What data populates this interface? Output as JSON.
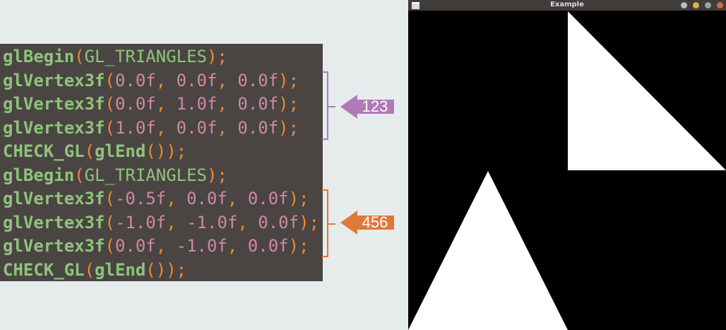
{
  "code": {
    "lines": [
      [
        [
          "fn",
          "glBegin"
        ],
        [
          "p",
          "("
        ],
        [
          "c",
          "GL_TRIANGLES"
        ],
        [
          "p",
          ");"
        ]
      ],
      [
        [
          "fn",
          "glVertex3f"
        ],
        [
          "p",
          "("
        ],
        [
          "n",
          "0.0f"
        ],
        [
          "p",
          ", "
        ],
        [
          "n",
          "0.0f"
        ],
        [
          "p",
          ", "
        ],
        [
          "n",
          "0.0f"
        ],
        [
          "p",
          ");"
        ]
      ],
      [
        [
          "fn",
          "glVertex3f"
        ],
        [
          "p",
          "("
        ],
        [
          "n",
          "0.0f"
        ],
        [
          "p",
          ", "
        ],
        [
          "n",
          "1.0f"
        ],
        [
          "p",
          ", "
        ],
        [
          "n",
          "0.0f"
        ],
        [
          "p",
          ");"
        ]
      ],
      [
        [
          "fn",
          "glVertex3f"
        ],
        [
          "p",
          "("
        ],
        [
          "n",
          "1.0f"
        ],
        [
          "p",
          ", "
        ],
        [
          "n",
          "0.0f"
        ],
        [
          "p",
          ", "
        ],
        [
          "n",
          "0.0f"
        ],
        [
          "p",
          ");"
        ]
      ],
      [
        [
          "fn",
          "CHECK_GL"
        ],
        [
          "p",
          "("
        ],
        [
          "fn",
          "glEnd"
        ],
        [
          "p",
          "());"
        ]
      ],
      [
        [
          "fn",
          "glBegin"
        ],
        [
          "p",
          "("
        ],
        [
          "c",
          "GL_TRIANGLES"
        ],
        [
          "p",
          ");"
        ]
      ],
      [
        [
          "fn",
          "glVertex3f"
        ],
        [
          "p",
          "("
        ],
        [
          "n",
          "-0.5f"
        ],
        [
          "p",
          ", "
        ],
        [
          "n",
          "0.0f"
        ],
        [
          "p",
          ", "
        ],
        [
          "n",
          "0.0f"
        ],
        [
          "p",
          ");"
        ]
      ],
      [
        [
          "fn",
          "glVertex3f"
        ],
        [
          "p",
          "("
        ],
        [
          "n",
          "-1.0f"
        ],
        [
          "p",
          ", "
        ],
        [
          "n",
          "-1.0f"
        ],
        [
          "p",
          ", "
        ],
        [
          "n",
          "0.0f"
        ],
        [
          "p",
          ");"
        ]
      ],
      [
        [
          "fn",
          "glVertex3f"
        ],
        [
          "p",
          "("
        ],
        [
          "n",
          "0.0f"
        ],
        [
          "p",
          ", "
        ],
        [
          "n",
          "-1.0f"
        ],
        [
          "p",
          ", "
        ],
        [
          "n",
          "0.0f"
        ],
        [
          "p",
          ");"
        ]
      ],
      [
        [
          "fn",
          "CHECK_GL"
        ],
        [
          "p",
          "("
        ],
        [
          "fn",
          "glEnd"
        ],
        [
          "p",
          "());"
        ]
      ]
    ]
  },
  "annotations": [
    {
      "label": "123",
      "color": "#b07ab8"
    },
    {
      "label": "456",
      "color": "#e07838"
    }
  ],
  "window": {
    "title": "Example",
    "buttons": [
      "#bbbbbb",
      "#e0b050",
      "#90a8a0",
      "#d06a40"
    ]
  }
}
